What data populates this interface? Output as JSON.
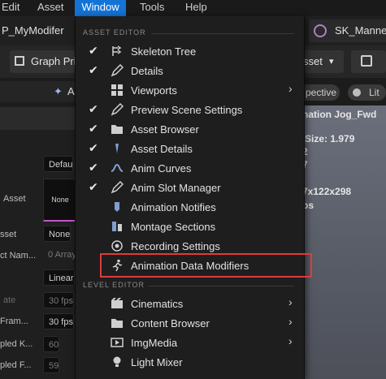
{
  "menubar": {
    "items": [
      "Edit",
      "Asset",
      "Window",
      "Tools",
      "Help"
    ]
  },
  "tabs": {
    "left_tab": "P_MyModifer",
    "right_tab": "SK_Manne"
  },
  "toolbar": {
    "graph_button": "Graph Pri",
    "asset_button": "sset"
  },
  "tabs2": {
    "left_label": "A"
  },
  "viewport": {
    "perspective": "pective",
    "lit": "Lit",
    "anim_name": "nation Jog_Fwd",
    "size": "Size: 1.979",
    "line2": "2",
    "line3": "7",
    "dims": "7x122x298",
    "fps": "ps"
  },
  "left_panel": {
    "rows": [
      {
        "label": "",
        "value": "Defau"
      },
      {
        "label": "Asset",
        "value": "None"
      },
      {
        "label": "sset",
        "value": "None"
      },
      {
        "label": "ct Nam...",
        "value": "0 Array"
      },
      {
        "label": "",
        "value": "Linear"
      },
      {
        "label": "ate",
        "value": "30 fps"
      },
      {
        "label": "Fram...",
        "value": "30 fps"
      },
      {
        "label": "pled K...",
        "value": "60"
      },
      {
        "label": "pled F...",
        "value": "59"
      }
    ]
  },
  "window_menu": {
    "asset_editor_section": "ASSET EDITOR",
    "level_editor_section": "LEVEL EDITOR",
    "asset_items": [
      {
        "label": "Skeleton Tree",
        "checked": true,
        "icon": "skeleton-tree-icon",
        "submenu": false
      },
      {
        "label": "Details",
        "checked": true,
        "icon": "pencil-icon",
        "submenu": false
      },
      {
        "label": "Viewports",
        "checked": false,
        "icon": "viewport-grid-icon",
        "submenu": true
      },
      {
        "label": "Preview Scene Settings",
        "checked": true,
        "icon": "pencil-icon",
        "submenu": false
      },
      {
        "label": "Asset Browser",
        "checked": true,
        "icon": "folder-icon",
        "submenu": false
      },
      {
        "label": "Asset Details",
        "checked": true,
        "icon": "asset-details-icon",
        "submenu": false
      },
      {
        "label": "Anim Curves",
        "checked": true,
        "icon": "curves-icon",
        "submenu": false
      },
      {
        "label": "Anim Slot Manager",
        "checked": true,
        "icon": "pencil-icon",
        "submenu": false
      },
      {
        "label": "Animation Notifies",
        "checked": false,
        "icon": "notify-icon",
        "submenu": false
      },
      {
        "label": "Montage Sections",
        "checked": false,
        "icon": "montage-icon",
        "submenu": false
      },
      {
        "label": "Recording Settings",
        "checked": false,
        "icon": "recording-icon",
        "submenu": false
      },
      {
        "label": "Animation Data Modifiers",
        "checked": false,
        "icon": "running-figure-icon",
        "submenu": false
      }
    ],
    "level_items": [
      {
        "label": "Cinematics",
        "icon": "film-icon",
        "submenu": true
      },
      {
        "label": "Content Browser",
        "icon": "folder-icon",
        "submenu": true
      },
      {
        "label": "ImgMedia",
        "icon": "film-icon",
        "submenu": true
      },
      {
        "label": "Light Mixer",
        "icon": "light-bulb-icon",
        "submenu": false
      }
    ]
  }
}
